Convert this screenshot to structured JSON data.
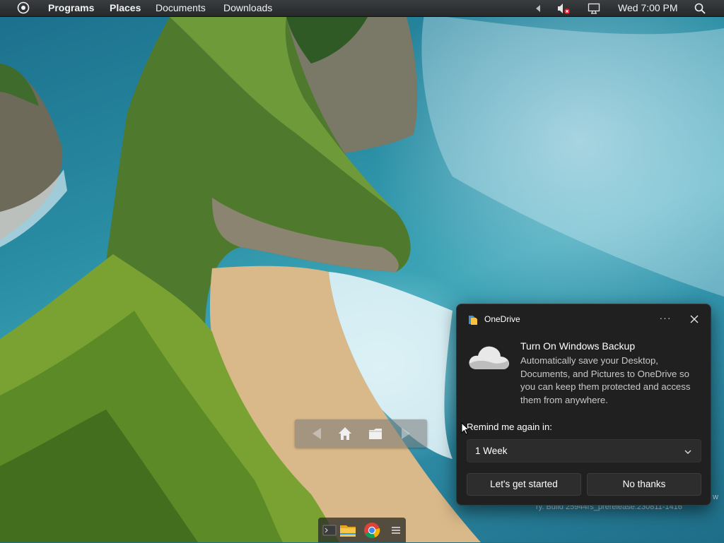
{
  "topbar": {
    "menus": [
      {
        "label": "Programs"
      },
      {
        "label": "Places"
      },
      {
        "label": "Documents"
      },
      {
        "label": "Downloads"
      }
    ],
    "clock": "Wed 7:00 PM",
    "icons": {
      "logo": "distro-logo-icon",
      "arrow": "tray-arrow-icon",
      "volume": "volume-muted-icon",
      "display": "display-icon",
      "search": "search-icon"
    }
  },
  "popup": {
    "app_name": "OneDrive",
    "title": "Turn On Windows Backup",
    "description": "Automatically save your Desktop, Documents, and Pictures to OneDrive so you can keep them protected and access them from anywhere.",
    "remind_label": "Remind me again in:",
    "remind_value": "1 Week",
    "primary_button": "Let's get started",
    "secondary_button": "No thanks",
    "more_label": "···"
  },
  "desktop": {
    "build_text": "ry. Build 25944rs_prerelease.230811-1416",
    "build_text_tail": "w"
  },
  "colors": {
    "panel_bg": "#2b2d2f",
    "popup_bg": "#202020",
    "button_bg": "#2d2d2d",
    "muted_badge": "#e81123"
  }
}
